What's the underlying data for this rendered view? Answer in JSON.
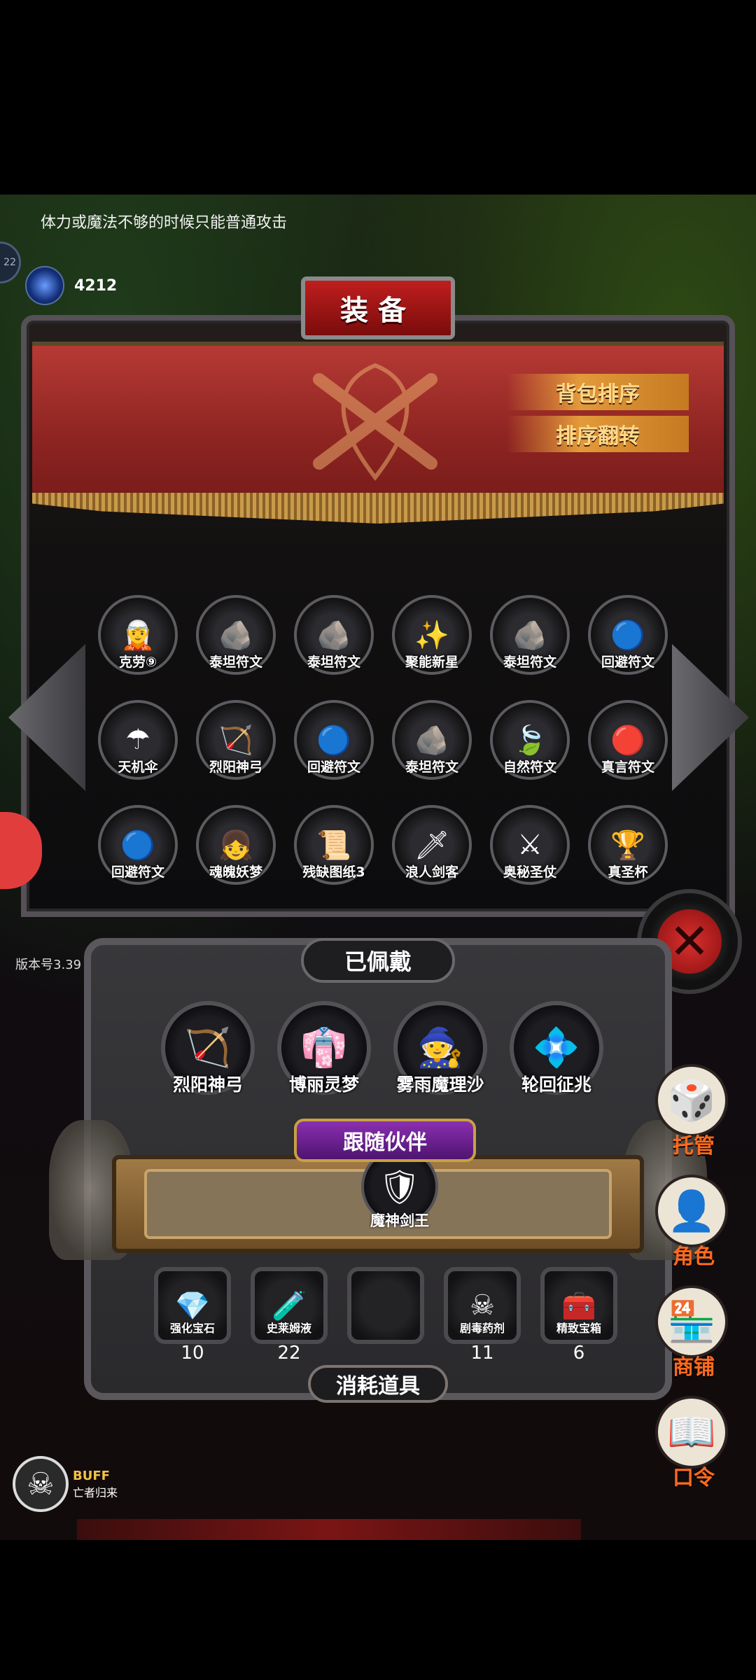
{
  "tip": "体力或魔法不够的时候只能普通攻击",
  "gem": {
    "icon": "blue-gem-icon",
    "value": "4212"
  },
  "side_ring": "22",
  "panel": {
    "title": "装备",
    "sort_button": "背包排序",
    "reverse_button": "排序翻转"
  },
  "inventory": [
    {
      "label": "克劳⑨",
      "icon": "character-icon",
      "glyph": "🧝"
    },
    {
      "label": "泰坦符文",
      "icon": "titan-rune-icon",
      "glyph": "🪨"
    },
    {
      "label": "泰坦符文",
      "icon": "titan-rune-icon",
      "glyph": "🪨"
    },
    {
      "label": "聚能新星",
      "icon": "nova-orb-icon",
      "glyph": "✨"
    },
    {
      "label": "泰坦符文",
      "icon": "titan-rune-icon",
      "glyph": "🪨"
    },
    {
      "label": "回避符文",
      "icon": "blue-rune-icon",
      "glyph": "🔵"
    },
    {
      "label": "天机伞",
      "icon": "umbrella-icon",
      "glyph": "☂"
    },
    {
      "label": "烈阳神弓",
      "icon": "bow-icon",
      "glyph": "🏹"
    },
    {
      "label": "回避符文",
      "icon": "blue-rune-icon",
      "glyph": "🔵"
    },
    {
      "label": "泰坦符文",
      "icon": "titan-rune-icon",
      "glyph": "🪨"
    },
    {
      "label": "自然符文",
      "icon": "nature-rune-icon",
      "glyph": "🍃"
    },
    {
      "label": "真言符文",
      "icon": "red-rune-icon",
      "glyph": "🔴"
    },
    {
      "label": "回避符文",
      "icon": "blue-rune-icon",
      "glyph": "🔵"
    },
    {
      "label": "魂魄妖梦",
      "icon": "character-icon",
      "glyph": "👧"
    },
    {
      "label": "残缺图纸3",
      "icon": "scroll-icon",
      "glyph": "📜"
    },
    {
      "label": "浪人剑客",
      "icon": "swordsman-icon",
      "glyph": "🗡"
    },
    {
      "label": "奥秘圣仗",
      "icon": "staff-icon",
      "glyph": "⚔"
    },
    {
      "label": "真圣杯",
      "icon": "grail-icon",
      "glyph": "🏆"
    }
  ],
  "version": "版本号3.39",
  "equipped": {
    "title": "已佩戴",
    "items": [
      {
        "label": "烈阳神弓",
        "icon": "bow-icon",
        "glyph": "🏹"
      },
      {
        "label": "博丽灵梦",
        "icon": "character-icon",
        "glyph": "👘"
      },
      {
        "label": "雾雨魔理沙",
        "icon": "character-icon",
        "glyph": "🧙"
      },
      {
        "label": "轮回征兆",
        "icon": "crystal-icon",
        "glyph": "💠"
      }
    ],
    "companion_title": "跟随伙伴",
    "companion": {
      "label": "魔神剑王",
      "icon": "armor-icon",
      "glyph": "🛡"
    },
    "consumables_title": "消耗道具",
    "consumables": [
      {
        "label": "强化宝石",
        "count": "10",
        "icon": "green-gem-icon",
        "glyph": "💎"
      },
      {
        "label": "史莱姆液",
        "count": "22",
        "icon": "potion-icon",
        "glyph": "🧪"
      },
      {
        "label": "",
        "count": "",
        "icon": "",
        "glyph": ""
      },
      {
        "label": "剧毒药剂",
        "count": "11",
        "icon": "poison-icon",
        "glyph": "☠"
      },
      {
        "label": "精致宝箱",
        "count": "6",
        "icon": "chest-icon",
        "glyph": "🧰"
      }
    ]
  },
  "menu": [
    {
      "label": "托管",
      "icon": "dice-icon",
      "glyph": "🎲"
    },
    {
      "label": "角色",
      "icon": "hood-icon",
      "glyph": "👤"
    },
    {
      "label": "商铺",
      "icon": "shop-icon",
      "glyph": "🏪"
    },
    {
      "label": "口令",
      "icon": "book-icon",
      "glyph": "📖"
    }
  ],
  "buff": {
    "title": "BUFF",
    "name": "亡者归来"
  }
}
